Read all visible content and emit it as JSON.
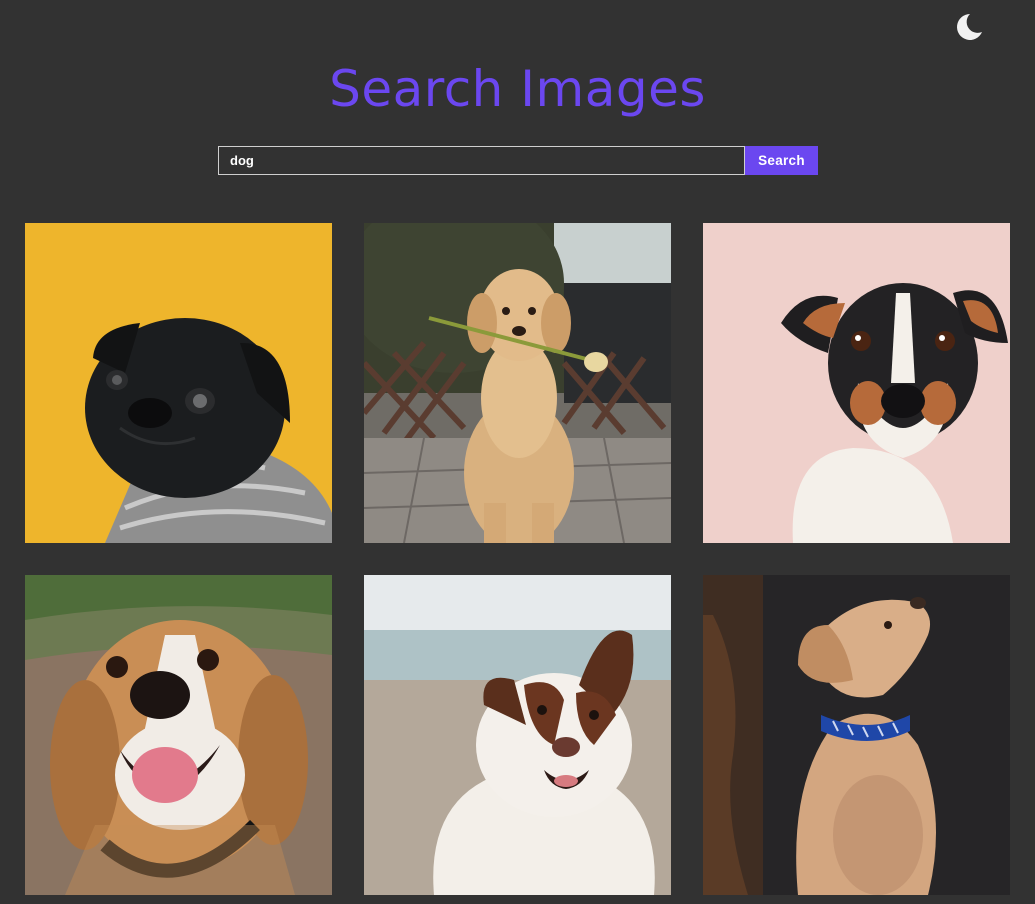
{
  "header": {
    "title": "Search Images",
    "theme_toggle_icon": "moon-icon"
  },
  "search": {
    "query": "dog",
    "button_label": "Search"
  },
  "colors": {
    "background": "#323232",
    "accent": "#6b47f0",
    "text": "#ffffff"
  },
  "results": [
    {
      "subject": "black pug wearing a knit sweater on yellow background",
      "icon": "image-thumbnail"
    },
    {
      "subject": "golden retriever puppy holding a tulip on a patio",
      "icon": "image-thumbnail"
    },
    {
      "subject": "jack russell terrier on pink background",
      "icon": "image-thumbnail"
    },
    {
      "subject": "smiling beagle with tongue out",
      "icon": "image-thumbnail"
    },
    {
      "subject": "fluffy brown and white dog at the beach",
      "icon": "image-thumbnail"
    },
    {
      "subject": "labrador puppy with blue collar looking up",
      "icon": "image-thumbnail"
    }
  ]
}
